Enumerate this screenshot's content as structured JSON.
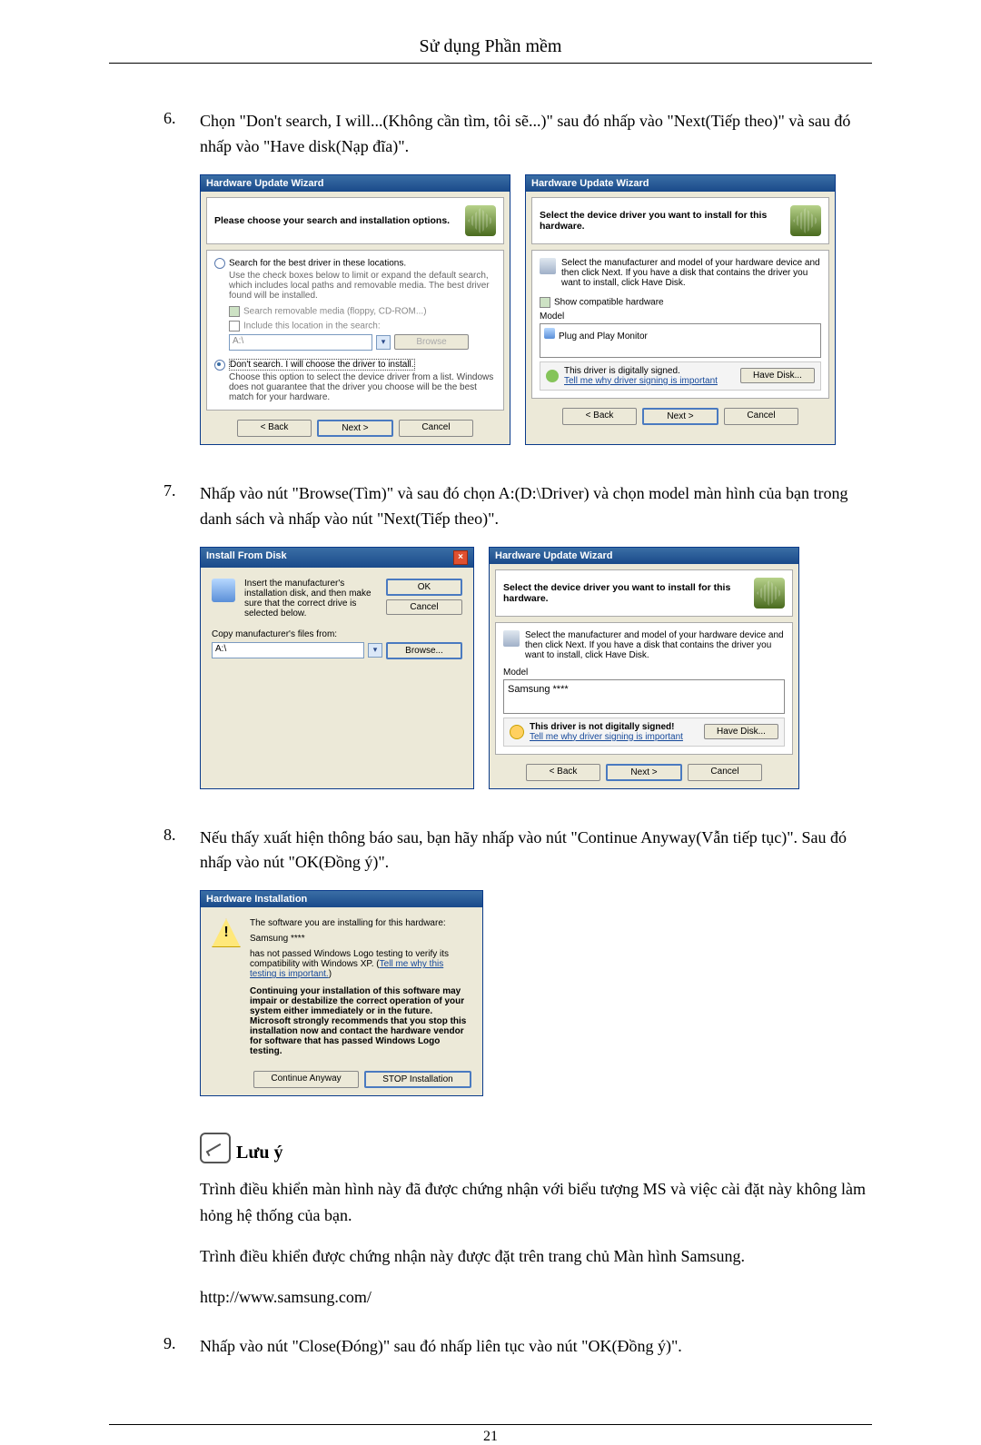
{
  "chapter_title": "Sử dụng Phần mềm",
  "steps": {
    "s6": {
      "num": "6.",
      "text": "Chọn \"Don't search, I will...(Không cần tìm, tôi sẽ...)\" sau đó nhấp vào \"Next(Tiếp theo)\" và sau đó nhấp vào \"Have disk(Nạp đĩa)\"."
    },
    "s7": {
      "num": "7.",
      "text": "Nhấp vào nút \"Browse(Tìm)\" và sau đó chọn A:(D:\\Driver) và chọn model màn hình của bạn trong danh sách và nhấp vào nút \"Next(Tiếp theo)\"."
    },
    "s8": {
      "num": "8.",
      "text": "Nếu thấy xuất hiện thông báo sau, bạn hãy nhấp vào nút \"Continue Anyway(Vẫn tiếp tục)\". Sau đó nhấp vào nút \"OK(Đồng ý)\"."
    },
    "s9": {
      "num": "9.",
      "text": "Nhấp vào nút \"Close(Đóng)\" sau đó nhấp liên tục vào nút \"OK(Đồng ý)\"."
    }
  },
  "wiz1": {
    "title": "Hardware Update Wizard",
    "header": "Please choose your search and installation options.",
    "opt1": "Search for the best driver in these locations.",
    "opt1_sub": "Use the check boxes below to limit or expand the default search, which includes local paths and removable media. The best driver found will be installed.",
    "chk1": "Search removable media (floppy, CD-ROM...)",
    "chk2": "Include this location in the search:",
    "path": "A:\\",
    "browse": "Browse",
    "opt2": "Don't search. I will choose the driver to install.",
    "opt2_sub": "Choose this option to select the device driver from a list. Windows does not guarantee that the driver you choose will be the best match for your hardware.",
    "back": "< Back",
    "next": "Next >",
    "cancel": "Cancel"
  },
  "wiz2": {
    "title": "Hardware Update Wizard",
    "header": "Select the device driver you want to install for this hardware.",
    "desc": "Select the manufacturer and model of your hardware device and then click Next. If you have a disk that contains the driver you want to install, click Have Disk.",
    "show": "Show compatible hardware",
    "model_lbl": "Model",
    "model_item": "Plug and Play Monitor",
    "sig": "This driver is digitally signed.",
    "siglink": "Tell me why driver signing is important",
    "have": "Have Disk...",
    "back": "< Back",
    "next": "Next >",
    "cancel": "Cancel"
  },
  "inst": {
    "title": "Install From Disk",
    "desc": "Insert the manufacturer's installation disk, and then make sure that the correct drive is selected below.",
    "ok": "OK",
    "cancel": "Cancel",
    "copy": "Copy manufacturer's files from:",
    "path": "A:\\",
    "browse": "Browse..."
  },
  "wiz3": {
    "title": "Hardware Update Wizard",
    "header": "Select the device driver you want to install for this hardware.",
    "desc": "Select the manufacturer and model of your hardware device and then click Next. If you have a disk that contains the driver you want to install, click Have Disk.",
    "model_lbl": "Model",
    "model_item": "Samsung ****",
    "sig": "This driver is not digitally signed!",
    "siglink": "Tell me why driver signing is important",
    "have": "Have Disk...",
    "back": "< Back",
    "next": "Next >",
    "cancel": "Cancel"
  },
  "hw": {
    "title": "Hardware Installation",
    "l1": "The software you are installing for this hardware:",
    "l2": "Samsung ****",
    "l3": "has not passed Windows Logo testing to verify its compatibility with Windows XP. (",
    "l3link": "Tell me why this testing is important.",
    "l3end": ")",
    "warn": "Continuing your installation of this software may impair or destabilize the correct operation of your system either immediately or in the future. Microsoft strongly recommends that you stop this installation now and contact the hardware vendor for software that has passed Windows Logo testing.",
    "cont": "Continue Anyway",
    "stop": "STOP Installation"
  },
  "note": {
    "head": "Lưu ý",
    "p1": "Trình điều khiển màn hình này đã được chứng nhận với biểu tượng MS và việc cài đặt này không làm hỏng hệ thống của bạn.",
    "p2": "Trình điều khiển được chứng nhận này được đặt trên trang chủ Màn hình Samsung.",
    "p3": "http://www.samsung.com/"
  },
  "page_number": "21"
}
